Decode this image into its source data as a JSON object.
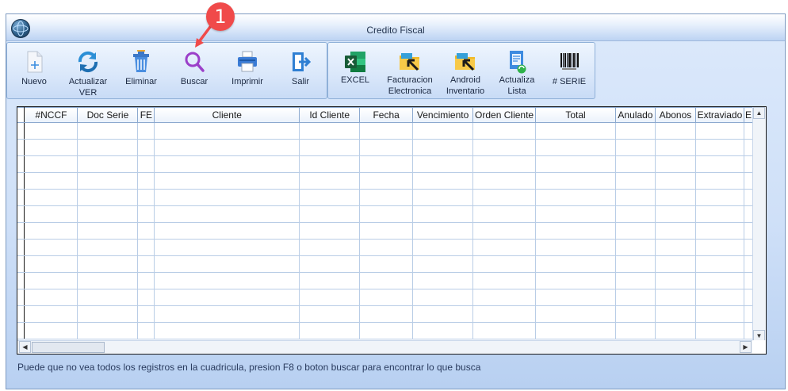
{
  "window": {
    "title": "Credito Fiscal"
  },
  "toolbar_main": [
    {
      "label": "Nuevo",
      "icon": "new-file-icon"
    },
    {
      "label": "Actualizar\nVER",
      "icon": "refresh-icon"
    },
    {
      "label": "Eliminar",
      "icon": "trash-icon"
    },
    {
      "label": "Buscar",
      "icon": "search-icon"
    },
    {
      "label": "Imprimir",
      "icon": "printer-icon"
    },
    {
      "label": "Salir",
      "icon": "exit-icon"
    }
  ],
  "toolbar_extra": [
    {
      "label": "EXCEL",
      "icon": "excel-icon"
    },
    {
      "label": "Facturacion\nElectronica",
      "icon": "folder-arrow-icon"
    },
    {
      "label": "Android\nInventario",
      "icon": "folder-arrow-icon"
    },
    {
      "label": "Actualiza\nLista",
      "icon": "document-refresh-icon"
    },
    {
      "label": "# SERIE",
      "icon": "barcode-icon"
    }
  ],
  "grid": {
    "columns": [
      "#NCCF",
      "Doc Serie",
      "FE",
      "Cliente",
      "Id Cliente",
      "Fecha",
      "Vencimiento",
      "Orden Cliente",
      "Total",
      "Anulado",
      "Abonos",
      "Extraviado",
      "E"
    ],
    "rows": 13
  },
  "hint": "Puede que no vea todos los registros en la cuadricula, presion F8 o boton buscar para encontrar lo que busca",
  "callout": {
    "number": "1"
  },
  "colors": {
    "callout": "#f04a4a",
    "accent": "#bcd3f3"
  }
}
